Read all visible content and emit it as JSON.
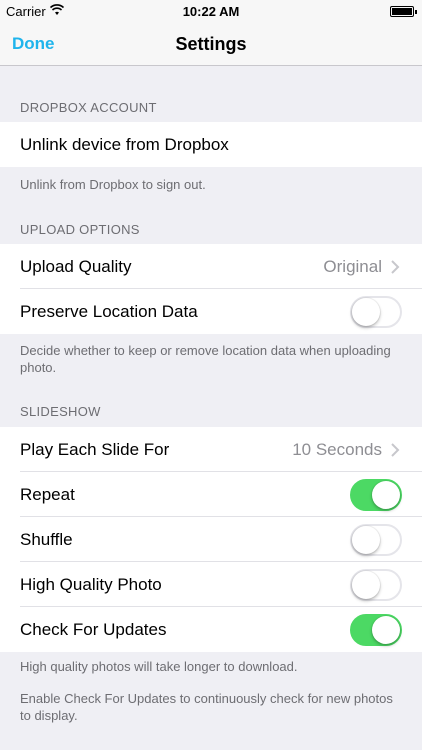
{
  "status": {
    "carrier": "Carrier",
    "time": "10:22 AM"
  },
  "nav": {
    "done": "Done",
    "title": "Settings"
  },
  "dropbox": {
    "header": "DROPBOX ACCOUNT",
    "unlink": "Unlink device from Dropbox",
    "footer": "Unlink from Dropbox to sign out."
  },
  "upload": {
    "header": "UPLOAD OPTIONS",
    "quality_label": "Upload Quality",
    "quality_value": "Original",
    "location_label": "Preserve Location Data",
    "location_on": false,
    "footer": "Decide whether to keep or remove location data when uploading photo."
  },
  "slideshow": {
    "header": "SLIDESHOW",
    "play_label": "Play Each Slide For",
    "play_value": "10 Seconds",
    "repeat_label": "Repeat",
    "repeat_on": true,
    "shuffle_label": "Shuffle",
    "shuffle_on": false,
    "hq_label": "High Quality Photo",
    "hq_on": false,
    "updates_label": "Check For Updates",
    "updates_on": true,
    "footer1": "High quality photos will take longer to download.",
    "footer2": "Enable Check For Updates to continuously check for new photos to display."
  },
  "colors": {
    "accent": "#1fb4ec",
    "switch_on": "#4cd964",
    "background": "#efeff4"
  }
}
